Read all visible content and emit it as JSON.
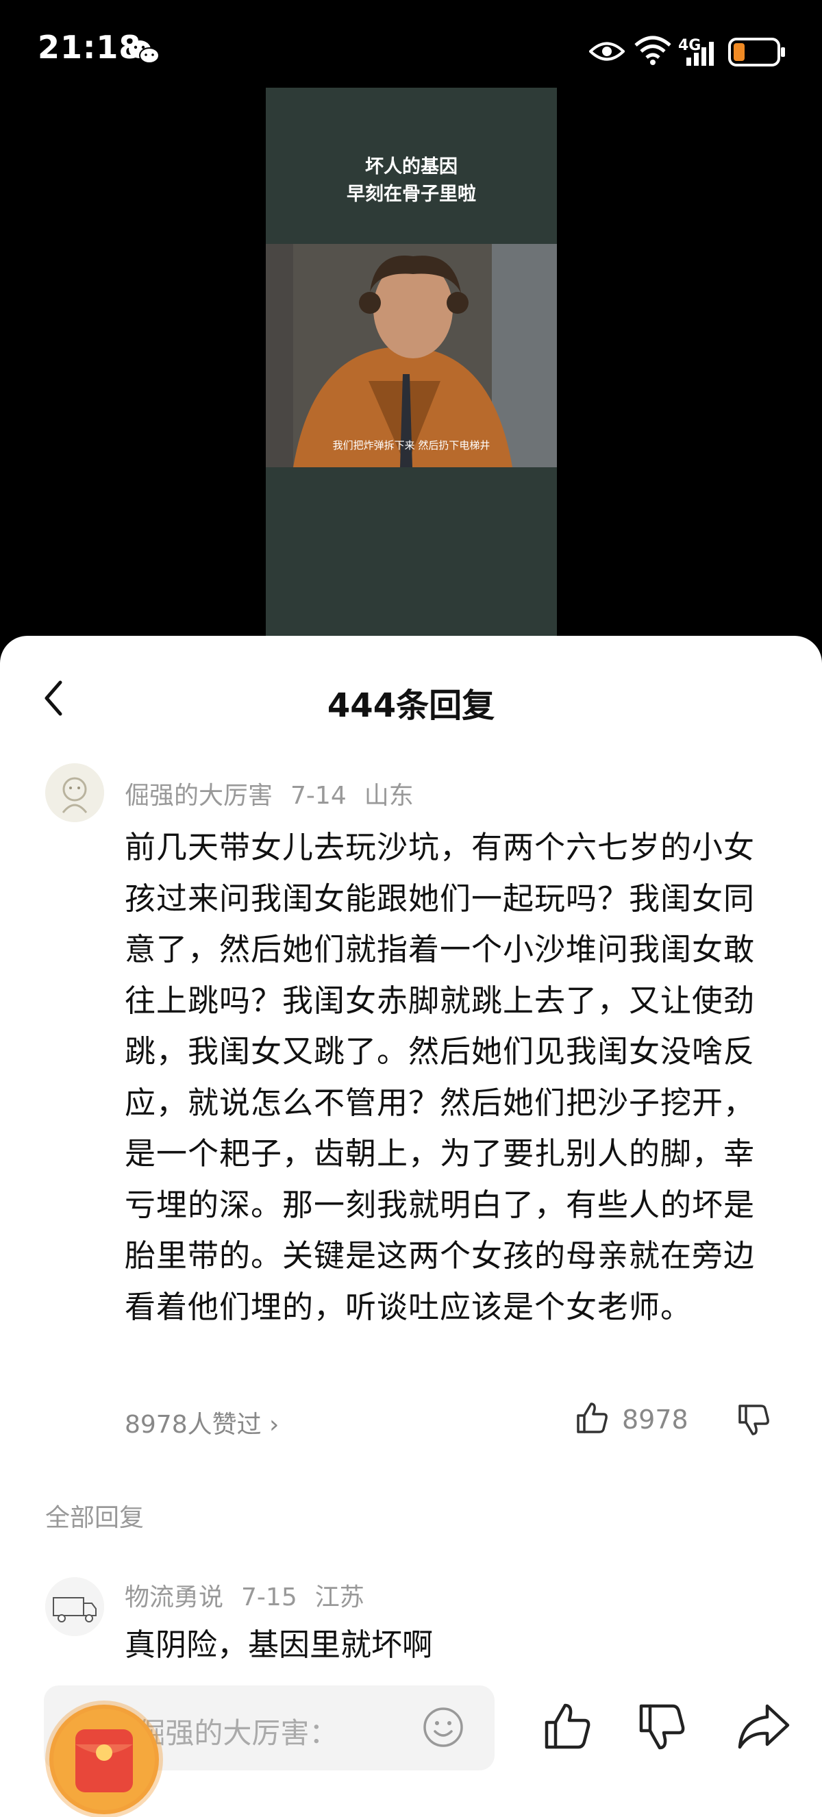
{
  "status_bar": {
    "time": "21:18",
    "network": "4G",
    "icons": [
      "wechat-icon",
      "eye-icon",
      "wifi-icon",
      "signal-icon",
      "battery-icon"
    ]
  },
  "video": {
    "caption_line1": "坏人的基因",
    "caption_line2": "早刻在骨子里啦",
    "subtitle": "我们把炸弹拆下来 然后扔下电梯井"
  },
  "sheet": {
    "title": "444条回复"
  },
  "main_comment": {
    "author": "倔强的大厉害",
    "date": "7-14",
    "location": "山东",
    "text": "前几天带女儿去玩沙坑，有两个六七岁的小女孩过来问我闺女能跟她们一起玩吗？我闺女同意了，然后她们就指着一个小沙堆问我闺女敢往上跳吗？我闺女赤脚就跳上去了，又让使劲跳，我闺女又跳了。然后她们见我闺女没啥反应，就说怎么不管用？然后她们把沙子挖开，是一个耙子，齿朝上，为了要扎别人的脚，幸亏埋的深。那一刻我就明白了，有些人的坏是胎里带的。关键是这两个女孩的母亲就在旁边看着他们埋的，听谈吐应该是个女老师。",
    "likes_link": "8978人赞过 ›",
    "like_count": "8978"
  },
  "all_replies_label": "全部回复",
  "reply": {
    "author": "物流勇说",
    "date": "7-15",
    "location": "江苏",
    "text": "真阴险，基因里就坏啊"
  },
  "input": {
    "placeholder": "回复 倔强的大厉害："
  },
  "colors": {
    "accent_red": "#e8473a",
    "accent_orange": "#f3a13a",
    "video_bg": "#2e3b37"
  }
}
